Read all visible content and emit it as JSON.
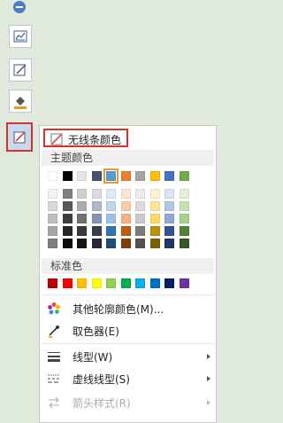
{
  "menu": {
    "no_stroke_label": "无线条颜色",
    "theme_header": "主题颜色",
    "standard_header": "标准色",
    "items": [
      {
        "label": "其他轮廓颜色(M)...",
        "icon": "color-wheel-icon"
      },
      {
        "label": "取色器(E)",
        "icon": "eyedropper-icon"
      },
      {
        "label": "线型(W)",
        "icon": "line-weight-icon"
      },
      {
        "label": "虚线线型(S)",
        "icon": "dash-style-icon"
      },
      {
        "label": "箭头样式(R)",
        "icon": "arrow-style-icon"
      }
    ]
  },
  "colors": {
    "theme_top": [
      "#ffffff",
      "#000000",
      "#e7e6e6",
      "#44546a",
      "#5b9bd5",
      "#ed7d31",
      "#a5a5a5",
      "#ffc000",
      "#4472c4",
      "#70ad47"
    ],
    "theme_shades": [
      [
        "#f2f2f2",
        "#7f7f7f",
        "#d0cece",
        "#d6dce4",
        "#deebf6",
        "#fbe5d5",
        "#ededed",
        "#fff2cc",
        "#dae3f3",
        "#e2efd9"
      ],
      [
        "#d8d8d8",
        "#595959",
        "#aeabab",
        "#adb9ca",
        "#bdd7ee",
        "#f7cbac",
        "#dbdbdb",
        "#fee599",
        "#b4c6e7",
        "#c5e0b3"
      ],
      [
        "#bfbfbf",
        "#3f3f3f",
        "#757070",
        "#8496b0",
        "#9cc3e5",
        "#f4b183",
        "#c9c9c9",
        "#ffd965",
        "#8eaadb",
        "#a8d08d"
      ],
      [
        "#a5a5a5",
        "#262626",
        "#3a3838",
        "#323f4f",
        "#2e75b5",
        "#c55a11",
        "#7b7b7b",
        "#bf9000",
        "#2f5496",
        "#538135"
      ],
      [
        "#7f7f7f",
        "#0c0c0c",
        "#171616",
        "#222a35",
        "#1e4e79",
        "#843c0b",
        "#525252",
        "#7f6000",
        "#1f3864",
        "#375623"
      ]
    ],
    "standard": [
      "#c00000",
      "#ff0000",
      "#ffc000",
      "#ffff00",
      "#92d050",
      "#00b050",
      "#00b0f0",
      "#0070c0",
      "#002060",
      "#7030a0"
    ]
  }
}
